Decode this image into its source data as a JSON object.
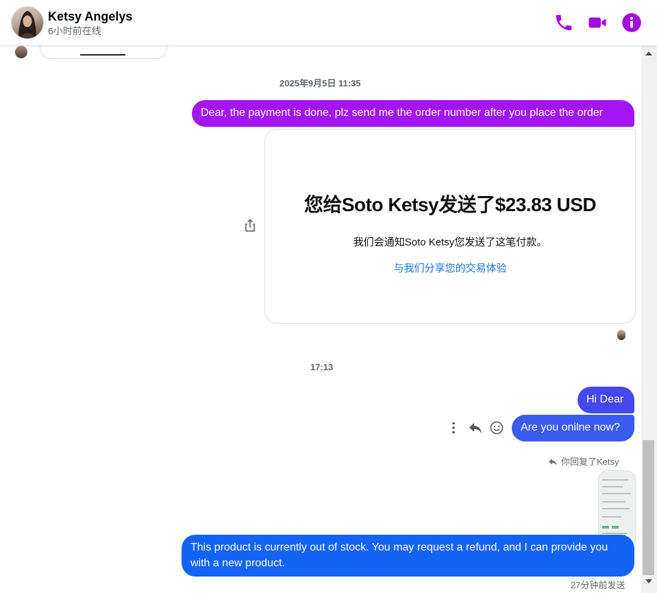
{
  "header": {
    "contact_name": "Ketsy Angelys",
    "status": "6小时前在线",
    "actions": [
      "phone-icon",
      "video-camera-icon",
      "info-icon"
    ],
    "accent_color": "#a30bdc"
  },
  "chat": {
    "timestamp_1": "2025年9月5日 11:35",
    "message_1": "Dear, the payment is done, plz send me the order number after you place the order",
    "payment_card": {
      "title": "您给Soto Ketsy发送了$23.83 USD",
      "subtitle": "我们会通知Soto Ketsy您发送了这笔付款。",
      "link": "与我们分享您的交易体验"
    },
    "timestamp_2": "17:13",
    "message_2": "Hi Dear",
    "message_3": "Are you onilne now?",
    "reply_note": "你回复了Ketsy",
    "message_4": "This product is currently out of stock. You may request a refund, and I can provide you with a new product.",
    "sent_status": "27分钟前发送"
  },
  "colors": {
    "bubble_purple": "#a315f2",
    "bubble_indigo": "#4547ef",
    "bubble_blue": "#1363f5",
    "link_blue": "#1a73e8"
  }
}
